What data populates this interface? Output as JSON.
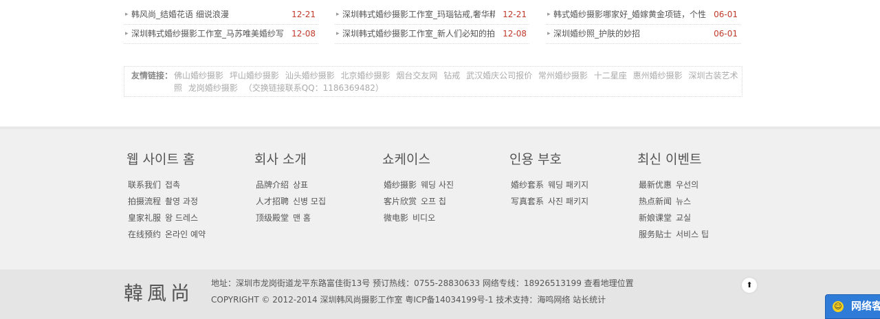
{
  "news": {
    "columns": [
      [
        {
          "title": "韩风尚_结婚花语 细说浪漫",
          "date": "12-21"
        },
        {
          "title": "深圳韩式婚纱摄影工作室_马苏唯美婚纱写",
          "date": "12-08"
        }
      ],
      [
        {
          "title": "深圳韩式婚纱摄影工作室_玛瑙钻戒,奢华精",
          "date": "12-21"
        },
        {
          "title": "深圳韩式婚纱摄影工作室_新人们必知的拍",
          "date": "12-08"
        }
      ],
      [
        {
          "title": "韩式婚纱摄影哪家好_婚嫁黄金项链，个性",
          "date": "06-01"
        },
        {
          "title": "深圳婚纱照_护肤的妙招",
          "date": "06-01"
        }
      ]
    ]
  },
  "friend_links": {
    "label": "友情链接：",
    "items": [
      "佛山婚纱摄影",
      "坪山婚纱摄影",
      "汕头婚纱摄影",
      "北京婚纱摄影",
      "烟台交友网",
      "钻戒",
      "武汉婚庆公司报价",
      "常州婚纱摄影",
      "十二星座",
      "惠州婚纱摄影",
      "深圳古装艺术照",
      "龙岗婚纱摄影"
    ],
    "contact": "（交换链接联系QQ：1186369482）"
  },
  "footer": {
    "columns": [
      {
        "title": "웹 사이트 홈",
        "items": [
          {
            "zh": "联系我们",
            "ko": "접촉"
          },
          {
            "zh": "拍摄流程",
            "ko": "촬영 과정"
          },
          {
            "zh": "皇家礼服",
            "ko": "왕 드레스"
          },
          {
            "zh": "在线预约",
            "ko": "온라인 예약"
          }
        ]
      },
      {
        "title": "회사 소개",
        "items": [
          {
            "zh": "品牌介绍",
            "ko": "상표"
          },
          {
            "zh": "人才招聘",
            "ko": "신병 모집"
          },
          {
            "zh": "顶级殿堂",
            "ko": "맨 홈"
          }
        ]
      },
      {
        "title": "쇼케이스",
        "items": [
          {
            "zh": "婚纱摄影",
            "ko": "웨딩 사진"
          },
          {
            "zh": "客片欣赏",
            "ko": "오프 칩"
          },
          {
            "zh": "微电影",
            "ko": "비디오"
          }
        ]
      },
      {
        "title": "인용 부호",
        "items": [
          {
            "zh": "婚纱套系",
            "ko": "웨딩 패키지"
          },
          {
            "zh": "写真套系",
            "ko": "사진 패키지"
          }
        ]
      },
      {
        "title": "최신 이벤트",
        "items": [
          {
            "zh": "最新优惠",
            "ko": "우선의"
          },
          {
            "zh": "热点新闻",
            "ko": "뉴스"
          },
          {
            "zh": "新娘课堂",
            "ko": "교실"
          },
          {
            "zh": "服务贴士",
            "ko": "서비스 팁"
          }
        ]
      }
    ]
  },
  "bottom": {
    "logo": "韓風尚",
    "address_line": "地址：深圳市龙岗街道龙平东路富佳街13号 预订热线：0755-28830633 网络专线：18926513199 查看地理位置",
    "copyright_line": "COPYRIGHT © 2012-2014 深圳韩风尚摄影工作室 粤ICP备14034199号-1 技术支持：海鸣网络  站长统计",
    "top_icon": "arrow-up-icon"
  },
  "float_widget": {
    "label": "网络客"
  }
}
